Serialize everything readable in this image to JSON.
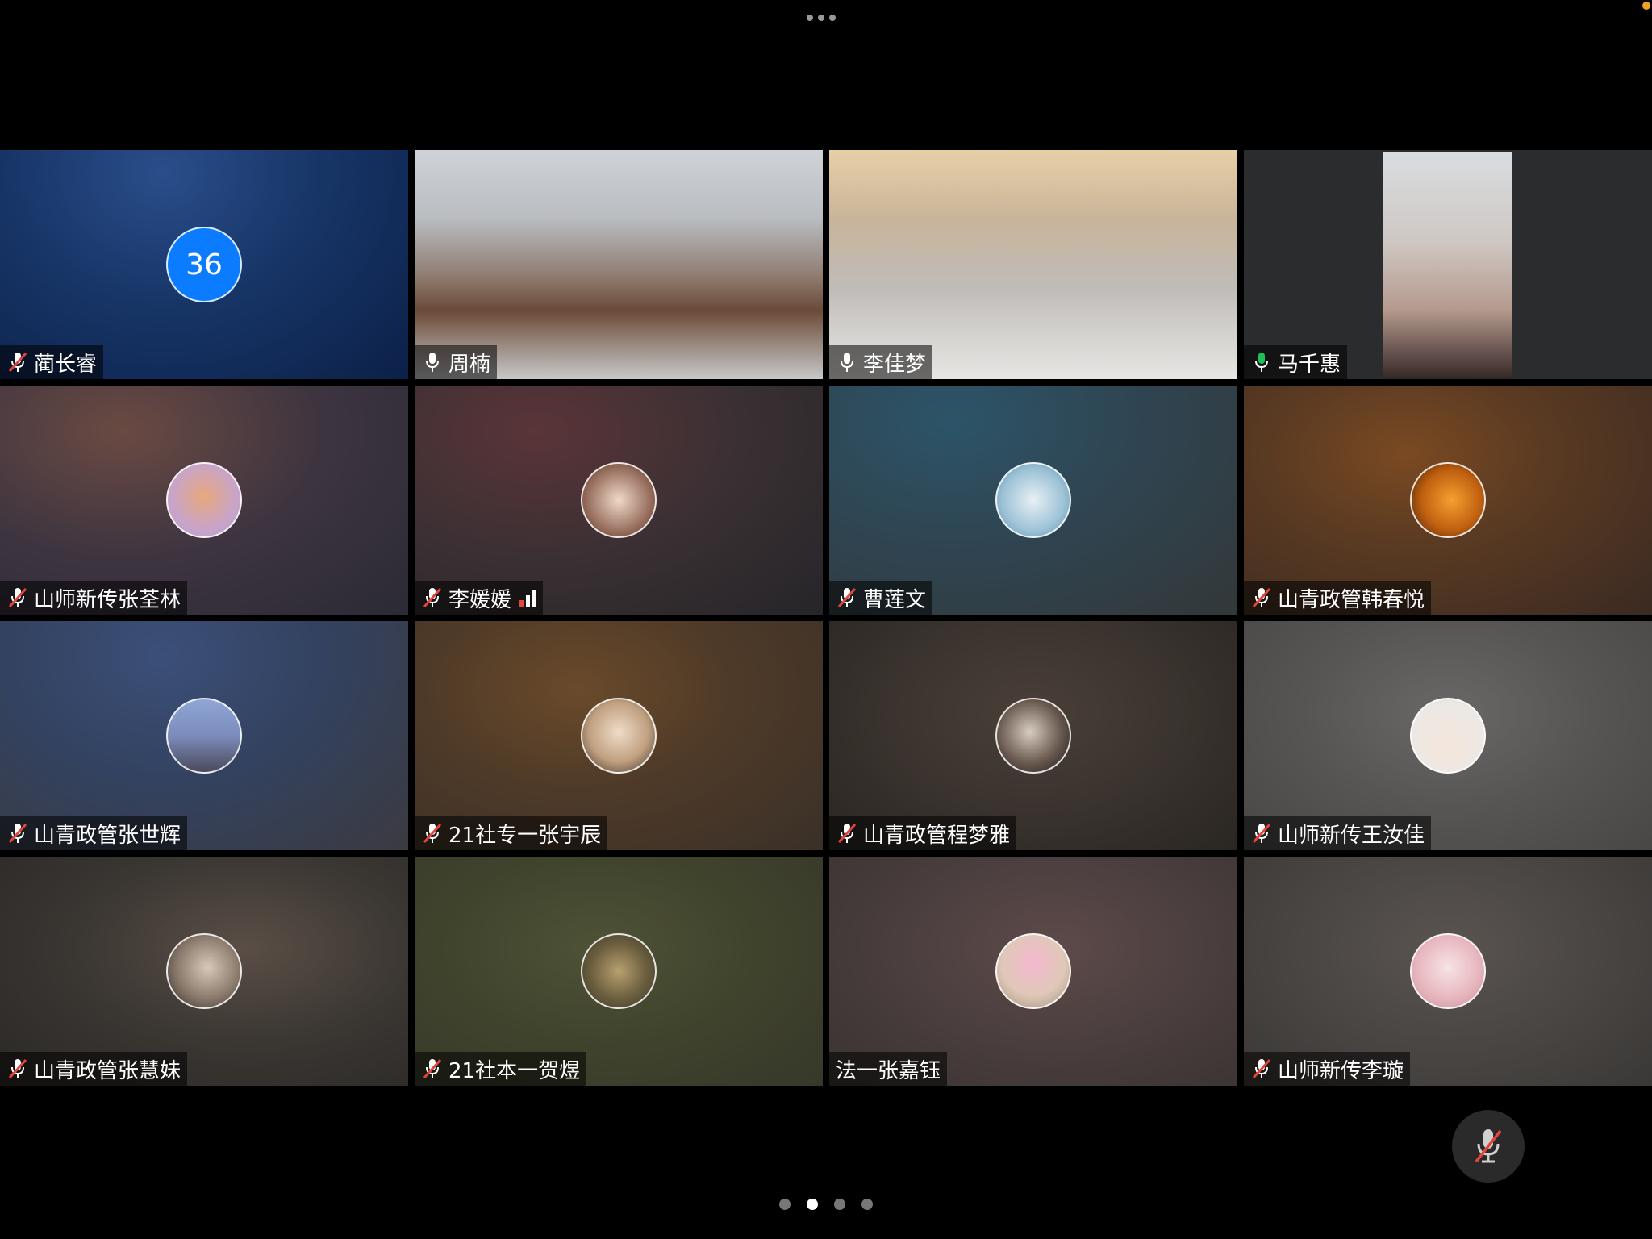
{
  "top_menu": {
    "icon": "more-horizontal-icon"
  },
  "participants": [
    {
      "name": "蔺长睿",
      "mic": "muted",
      "display": "number-avatar",
      "avatar_text": "36"
    },
    {
      "name": "周楠",
      "mic": "on",
      "display": "video"
    },
    {
      "name": "李佳梦",
      "mic": "on",
      "display": "video"
    },
    {
      "name": "马千惠",
      "mic": "speaking",
      "display": "video",
      "active_speaker": true
    },
    {
      "name": "山师新传张荃林",
      "mic": "muted",
      "display": "avatar"
    },
    {
      "name": "李媛媛",
      "mic": "muted",
      "display": "avatar",
      "signal": "weak"
    },
    {
      "name": "曹莲文",
      "mic": "muted",
      "display": "avatar"
    },
    {
      "name": "山青政管韩春悦",
      "mic": "muted",
      "display": "avatar"
    },
    {
      "name": "山青政管张世辉",
      "mic": "muted",
      "display": "avatar"
    },
    {
      "name": "21社专一张宇辰",
      "mic": "muted",
      "display": "avatar"
    },
    {
      "name": "山青政管程梦雅",
      "mic": "muted",
      "display": "avatar"
    },
    {
      "name": "山师新传王汝佳",
      "mic": "muted",
      "display": "avatar"
    },
    {
      "name": "山青政管张慧妹",
      "mic": "muted",
      "display": "avatar"
    },
    {
      "name": "21社本一贺煜",
      "mic": "muted",
      "display": "avatar"
    },
    {
      "name": "法一张嘉钰",
      "mic": "none",
      "display": "avatar"
    },
    {
      "name": "山师新传李璇",
      "mic": "muted",
      "display": "avatar"
    }
  ],
  "controls": {
    "mute_button_icon": "mic-muted-icon"
  },
  "pager": {
    "pages": 4,
    "current": 2
  },
  "colors": {
    "active_speaker_border": "#1ec05a",
    "muted_icon": "#e0463c",
    "number_avatar": "#0b7cff"
  }
}
